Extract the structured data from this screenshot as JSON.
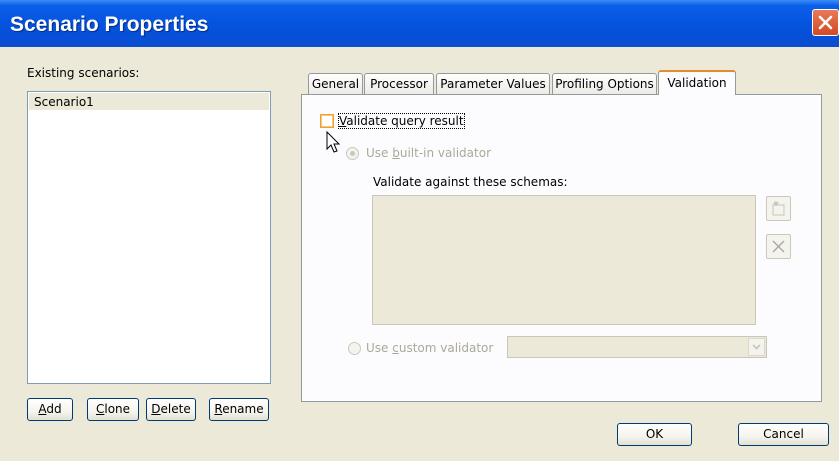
{
  "window": {
    "title": "Scenario Properties",
    "close_icon": "close-icon"
  },
  "left": {
    "existing_label": "Existing scenarios:",
    "scenarios": [
      "Scenario1"
    ],
    "buttons": {
      "add": {
        "mn": "A",
        "rest": "dd"
      },
      "clone": {
        "mn": "C",
        "rest": "lone"
      },
      "delete": {
        "mn": "D",
        "rest": "elete"
      },
      "rename": {
        "mn": "R",
        "rest": "ename"
      }
    }
  },
  "tabs": [
    "General",
    "Processor",
    "Parameter Values",
    "Profiling Options",
    "Validation"
  ],
  "active_tab": "Validation",
  "validation": {
    "validate_checkbox": {
      "mn": "V",
      "rest": "alidate query result",
      "checked": false
    },
    "builtin_radio": {
      "pre": "Use ",
      "mn": "b",
      "rest": "uilt-in validator",
      "selected": true,
      "enabled": false
    },
    "schemas_label": "Validate against these schemas:",
    "custom_radio": {
      "pre": "Use ",
      "mn": "c",
      "rest": "ustom validator",
      "selected": false,
      "enabled": false
    },
    "custom_combo_value": ""
  },
  "footer": {
    "ok": "OK",
    "cancel": "Cancel"
  },
  "colors": {
    "title_bar": "#0555e0",
    "dialog_bg": "#ece9d8",
    "active_tab_accent": "#e68b2c"
  }
}
